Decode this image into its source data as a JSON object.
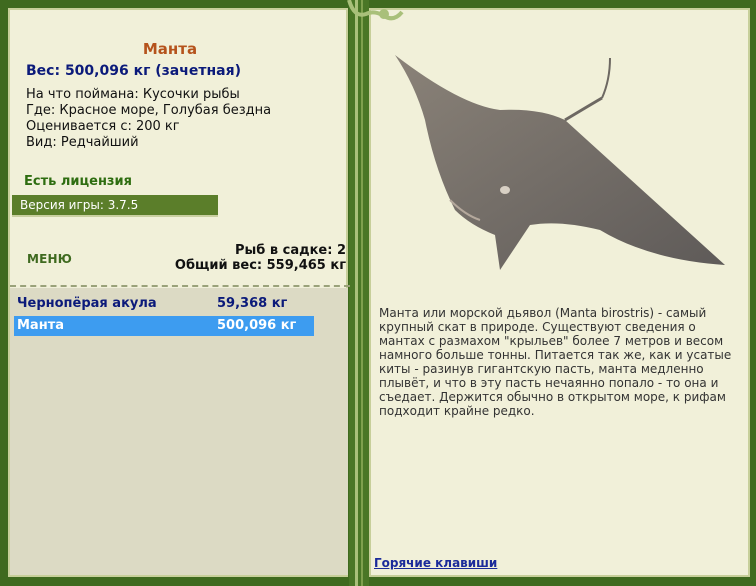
{
  "fish": {
    "name": "Манта",
    "weight": "Вес: 500,096 кг (зачетная)",
    "caught_on": "На что поймана: Кусочки рыбы",
    "where": "Где: Красное море, Голубая бездна",
    "rated_from": "Оценивается с: 200 кг",
    "kind": "Вид: Редчайший",
    "license": "Есть лицензия"
  },
  "version": "Версия игры: 3.7.5",
  "menu_label": "МЕНЮ",
  "cage": {
    "count_label": "Рыб в садке: 2",
    "total_label": "Общий вес: 559,465 кг"
  },
  "catch_list": [
    {
      "name": "Чернопёрая акула",
      "weight": "59,368 кг",
      "selected": false
    },
    {
      "name": "Манта",
      "weight": "500,096 кг",
      "selected": true
    }
  ],
  "description": "Манта или морской дьявол (Manta birostris) - самый крупный скат в природе. Существуют сведения о мантах с размахом \"крыльев\" более 7 метров и весом намного больше тонны. Питается так же, как и усатые киты - разинув гигантскую пасть, манта медленно плывёт, и что в эту пасть нечаянно попало - то она и съедает. Держится обычно в открытом море, к рифам подходит крайне редко.",
  "hotkeys_link": "Горячие клавиши",
  "colors": {
    "frame_green": "#3f6a1f",
    "panel_bg": "#f1f0d9",
    "selection": "#3d9cf0",
    "fish_title": "#b5531c",
    "weight_blue": "#0b1a7a"
  }
}
